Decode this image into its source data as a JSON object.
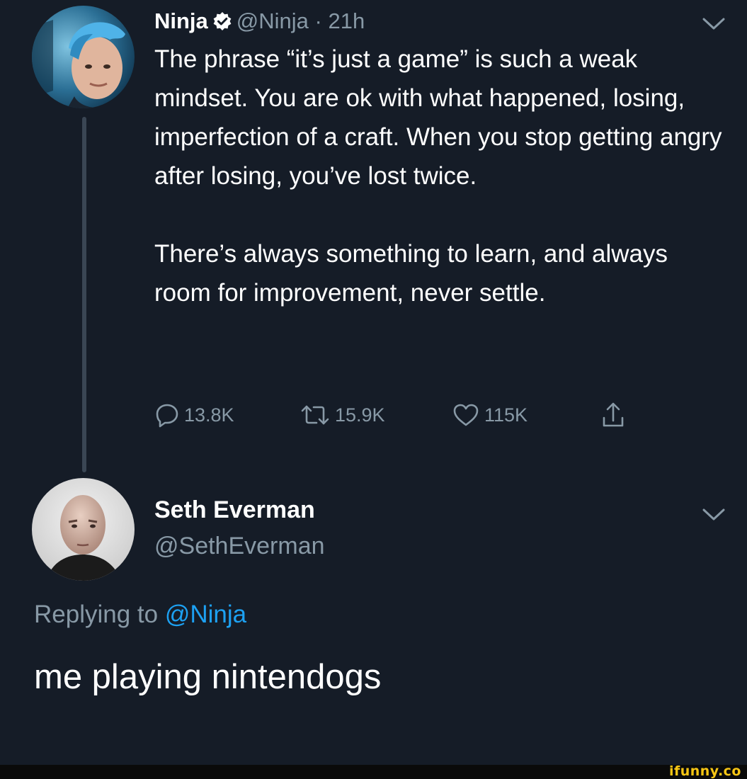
{
  "tweet": {
    "author_name": "Ninja",
    "handle_time": "@Ninja · 21h",
    "paragraphs": [
      "The phrase “it’s just a game” is such a weak mindset. You are ok with what happened, losing, imperfection of a craft. When you stop getting angry after losing, you’ve lost twice.",
      "There’s always something to learn, and always room for improvement, never settle."
    ],
    "actions": {
      "replies": "13.8K",
      "retweets": "15.9K",
      "likes": "115K"
    }
  },
  "reply": {
    "author_name": "Seth Everman",
    "handle": "@SethEverman",
    "replying_prefix": "Replying to",
    "replying_mention": "@Ninja",
    "text": "me playing nintendogs"
  },
  "watermark": "ifunny.co",
  "colors": {
    "background": "#151c27",
    "text_primary": "#ffffff",
    "text_secondary": "#8899a6",
    "link": "#1da1f2",
    "watermark": "#f7c614"
  },
  "icons": {
    "verified": "verified-badge-icon",
    "reply": "reply-bubble-icon",
    "retweet": "retweet-icon",
    "like": "heart-icon",
    "share": "share-icon",
    "menu": "chevron-down-icon"
  }
}
